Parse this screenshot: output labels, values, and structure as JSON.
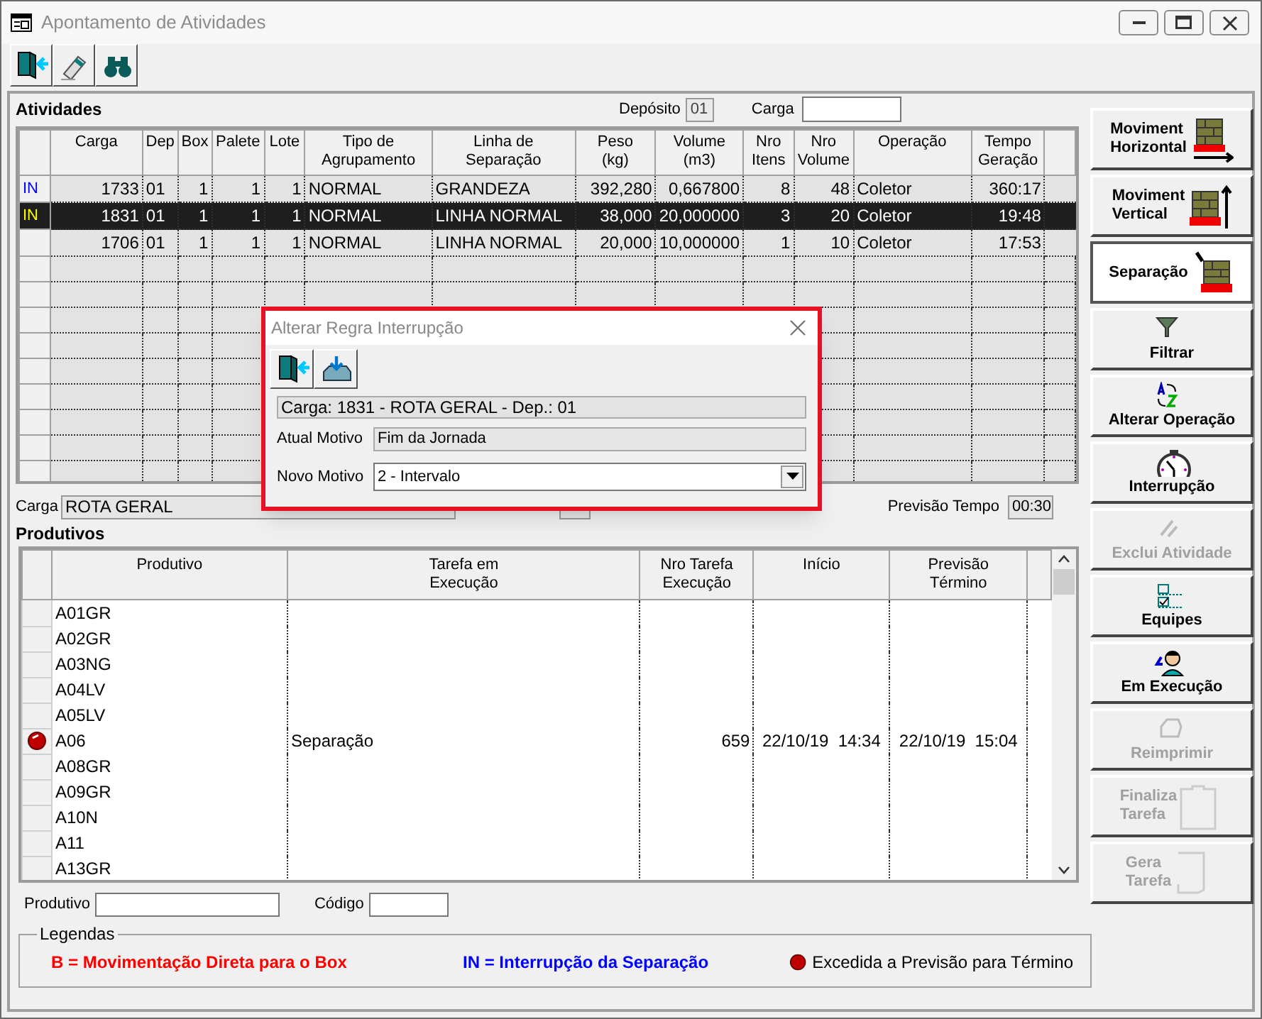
{
  "window": {
    "title": "Apontamento de Atividades"
  },
  "atividades": {
    "title": "Atividades",
    "deposito": {
      "label": "Depósito",
      "value": "01"
    },
    "carga_filter": {
      "label": "Carga"
    },
    "columns": [
      "Carga",
      "Dep",
      "Box",
      "Palete",
      "Lote",
      "Tipo de\nAgrupamento",
      "Linha de\nSeparação",
      "Peso\n(kg)",
      "Volume\n(m3)",
      "Nro\nItens",
      "Nro\nVolume",
      "Operação",
      "Tempo\nGeração"
    ],
    "rows": [
      {
        "flag": "IN",
        "cells": [
          "1733",
          "01",
          "1",
          "1",
          "1",
          "NORMAL",
          "GRANDEZA",
          "392,280",
          "0,667800",
          "8",
          "48",
          "Coletor",
          "360:17"
        ],
        "selected": false
      },
      {
        "flag": "IN",
        "cells": [
          "1831",
          "01",
          "1",
          "1",
          "1",
          "NORMAL",
          "LINHA NORMAL",
          "38,000",
          "20,000000",
          "3",
          "20",
          "Coletor",
          "19:48"
        ],
        "selected": true
      },
      {
        "cells": [
          "1706",
          "01",
          "1",
          "1",
          "1",
          "NORMAL",
          "LINHA NORMAL",
          "20,000",
          "10,000000",
          "1",
          "10",
          "Coletor",
          "17:53"
        ],
        "selected": false
      }
    ]
  },
  "carga_info": {
    "label": "Carga",
    "value": "ROTA GERAL",
    "previsao_label": "Previsão Tempo",
    "previsao_value": "00:30"
  },
  "produtivos": {
    "title": "Produtivos",
    "columns": [
      "Produtivo",
      "Tarefa em\nExecução",
      "Nro Tarefa\nExecução",
      "Início",
      "Previsão\nTérmino"
    ],
    "rows": [
      {
        "produtivo": "A01GR",
        "exceeded": false
      },
      {
        "produtivo": "A02GR",
        "exceeded": false
      },
      {
        "produtivo": "A03NG",
        "exceeded": false
      },
      {
        "produtivo": "A04LV",
        "exceeded": false
      },
      {
        "produtivo": "A05LV",
        "exceeded": false
      },
      {
        "produtivo": "A06",
        "tarefa": "Separação",
        "nro": "659",
        "inicio": "22/10/19  14:34",
        "previsao": "22/10/19  15:04",
        "exceeded": true
      },
      {
        "produtivo": "A08GR",
        "exceeded": false
      },
      {
        "produtivo": "A09GR",
        "exceeded": false
      },
      {
        "produtivo": "A10N",
        "exceeded": false
      },
      {
        "produtivo": "A11",
        "exceeded": false
      },
      {
        "produtivo": "A13GR",
        "exceeded": false
      }
    ]
  },
  "filters": {
    "produtivo_label": "Produtivo",
    "codigo_label": "Código"
  },
  "legend": {
    "title": "Legendas",
    "items": [
      {
        "kind": "text",
        "symbol": "B",
        "text": "= Movimentação Direta para o Box",
        "color": "#ff0000"
      },
      {
        "kind": "text",
        "symbol": "IN",
        "text": "= Interrupção da Separação",
        "color": "#0000ff"
      },
      {
        "kind": "dot",
        "text": "Excedida a Previsão para Término",
        "color": "#c00000"
      }
    ]
  },
  "side_buttons": [
    {
      "label": "Moviment\nHorizontal",
      "kind": "side",
      "disabled": false,
      "selected": false
    },
    {
      "label": "Moviment\nVertical",
      "kind": "side",
      "disabled": false,
      "selected": false
    },
    {
      "label": "Separação",
      "kind": "side",
      "disabled": false,
      "selected": true
    },
    {
      "label": "Filtrar",
      "kind": "stacked",
      "disabled": false,
      "selected": false
    },
    {
      "label": "Alterar Operação",
      "kind": "stacked",
      "disabled": false,
      "selected": false
    },
    {
      "label": "Interrupção",
      "kind": "stacked",
      "disabled": false,
      "selected": false
    },
    {
      "label": "Exclui Atividade",
      "kind": "stacked",
      "disabled": true,
      "selected": false
    },
    {
      "label": "Equipes",
      "kind": "stacked",
      "disabled": false,
      "selected": false
    },
    {
      "label": "Em Execução",
      "kind": "stacked",
      "disabled": false,
      "selected": false
    },
    {
      "label": "Reimprimir",
      "kind": "stacked",
      "disabled": true,
      "selected": false
    },
    {
      "label": "Finaliza\nTarefa",
      "kind": "side",
      "disabled": true,
      "selected": false
    },
    {
      "label": "Gera\nTarefa",
      "kind": "side",
      "disabled": true,
      "selected": false
    }
  ],
  "dialog": {
    "title": "Alterar Regra Interrupção",
    "info": "Carga: 1831 - ROTA GERAL - Dep.: 01",
    "atual": {
      "label": "Atual Motivo",
      "value": "Fim da Jornada"
    },
    "novo": {
      "label": "Novo Motivo",
      "value": "2 - Intervalo"
    }
  }
}
